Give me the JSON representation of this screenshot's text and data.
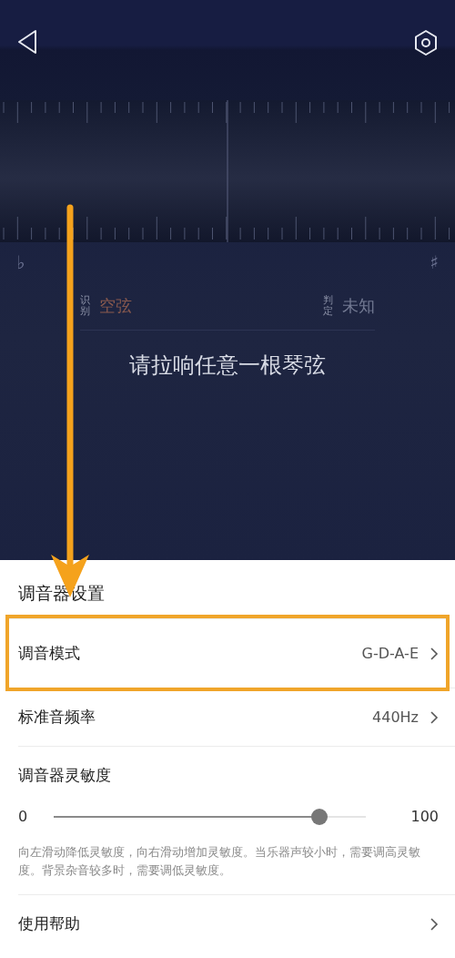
{
  "tuner": {
    "flat_symbol": "♭",
    "sharp_symbol": "♯",
    "detect_label": "识别",
    "detect_value": "空弦",
    "judge_label": "判定",
    "judge_value": "未知",
    "prompt": "请拉响任意一根琴弦"
  },
  "settings": {
    "title": "调音器设置",
    "rows": [
      {
        "kind": "link",
        "label": "调音模式",
        "value": "G-D-A-E",
        "highlighted": true
      },
      {
        "kind": "link",
        "label": "标准音频率",
        "value": "440Hz",
        "highlighted": false
      },
      {
        "kind": "slider",
        "label": "调音器灵敏度",
        "min": "0",
        "max": "100",
        "level": 0.85,
        "hint": "向左滑动降低灵敏度，向右滑动增加灵敏度。当乐器声较小时，需要调高灵敏度。背景杂音较多时，需要调低灵敏度。"
      },
      {
        "kind": "link",
        "label": "使用帮助",
        "highlighted": false
      }
    ]
  }
}
